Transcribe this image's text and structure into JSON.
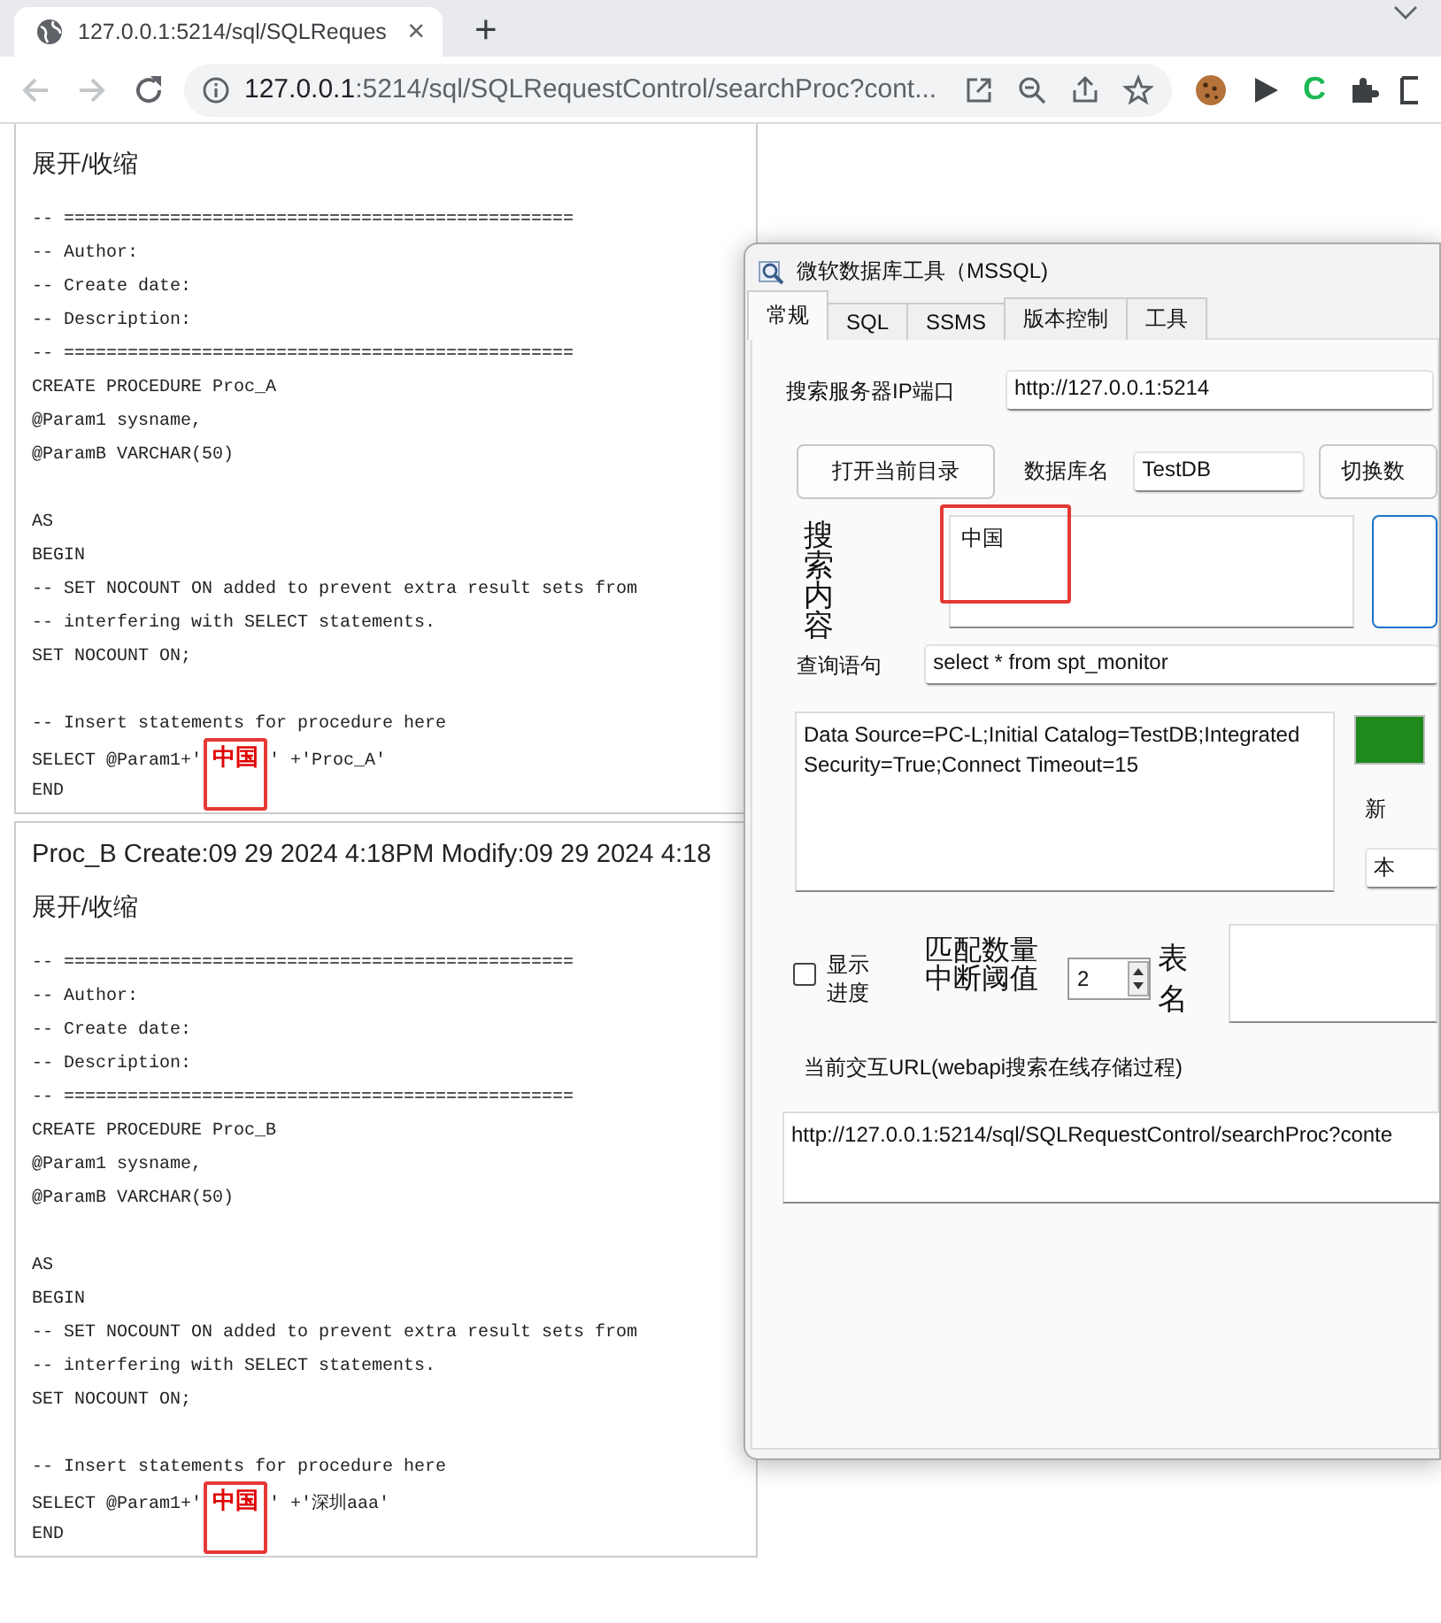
{
  "browser": {
    "tab": {
      "title": "127.0.0.1:5214/sql/SQLReques",
      "close": "×",
      "selected": true
    },
    "new_tab": "+",
    "navigation": [
      {
        "kind": "back",
        "disabled": true
      },
      {
        "kind": "forward",
        "disabled": true
      },
      {
        "kind": "reload",
        "disabled": false
      }
    ],
    "address": {
      "host": "127.0.0.1",
      "path": ":5214/sql/SQLRequestControl/searchProc?cont..."
    },
    "extensions": [
      {
        "kind": "cookie"
      },
      {
        "kind": "play"
      },
      {
        "kind": "letter",
        "text": "C"
      },
      {
        "kind": "puzzle"
      },
      {
        "kind": "panel"
      }
    ]
  },
  "results": [
    {
      "toggle": "展开/收缩",
      "lines": [
        {
          "kind": "code",
          "text": "-- ================================================"
        },
        {
          "kind": "code",
          "text": "-- Author:"
        },
        {
          "kind": "code",
          "text": "-- Create date:"
        },
        {
          "kind": "code",
          "text": "-- Description:"
        },
        {
          "kind": "code",
          "text": "-- ================================================"
        },
        {
          "kind": "code",
          "text": "CREATE PROCEDURE Proc_A"
        },
        {
          "kind": "code",
          "text": "@Param1 sysname,"
        },
        {
          "kind": "code",
          "text": "@ParamB VARCHAR(50)"
        },
        {
          "kind": "blank"
        },
        {
          "kind": "code",
          "text": "AS"
        },
        {
          "kind": "code",
          "text": "BEGIN"
        },
        {
          "kind": "code",
          "text": "-- SET NOCOUNT ON added to prevent extra result sets from"
        },
        {
          "kind": "code",
          "text": "-- interfering with SELECT statements."
        },
        {
          "kind": "code",
          "text": "SET NOCOUNT ON;"
        },
        {
          "kind": "blank"
        },
        {
          "kind": "code",
          "text": "-- Insert statements for procedure here"
        },
        {
          "kind": "match",
          "segments": [
            {
              "text": "SELECT @Param1+'",
              "match": false
            },
            {
              "text": "中国",
              "match": true,
              "boxed": true
            },
            {
              "text": "' +'Proc_A'",
              "match": false
            }
          ]
        },
        {
          "kind": "code",
          "text": "END"
        }
      ]
    },
    {
      "header": "Proc_B Create:09 29 2024 4:18PM Modify:09 29 2024 4:18",
      "toggle": "展开/收缩",
      "lines": [
        {
          "kind": "code",
          "text": "-- ================================================"
        },
        {
          "kind": "code",
          "text": "-- Author:"
        },
        {
          "kind": "code",
          "text": "-- Create date:"
        },
        {
          "kind": "code",
          "text": "-- Description:"
        },
        {
          "kind": "code",
          "text": "-- ================================================"
        },
        {
          "kind": "code",
          "text": "CREATE PROCEDURE Proc_B"
        },
        {
          "kind": "code",
          "text": "@Param1 sysname,"
        },
        {
          "kind": "code",
          "text": "@ParamB VARCHAR(50)"
        },
        {
          "kind": "blank"
        },
        {
          "kind": "code",
          "text": "AS"
        },
        {
          "kind": "code",
          "text": "BEGIN"
        },
        {
          "kind": "code",
          "text": "-- SET NOCOUNT ON added to prevent extra result sets from"
        },
        {
          "kind": "code",
          "text": "-- interfering with SELECT statements."
        },
        {
          "kind": "code",
          "text": "SET NOCOUNT ON;"
        },
        {
          "kind": "blank"
        },
        {
          "kind": "code",
          "text": "-- Insert statements for procedure here"
        },
        {
          "kind": "match",
          "segments": [
            {
              "text": "SELECT @Param1+'",
              "match": false
            },
            {
              "text": "中国",
              "match": true,
              "boxed": true
            },
            {
              "text": "' +'深圳aaa'",
              "match": false
            }
          ]
        },
        {
          "kind": "code",
          "text": "END"
        }
      ]
    }
  ],
  "dialog": {
    "title": "微软数据库工具（MSSQL)",
    "tabs": [
      {
        "label": "常规",
        "selected": true
      },
      {
        "label": "SQL",
        "selected": false
      },
      {
        "label": "SSMS",
        "selected": false
      },
      {
        "label": "版本控制",
        "selected": false
      },
      {
        "label": "工具",
        "selected": false
      }
    ],
    "server": {
      "label": "搜索服务器IP端口",
      "value": "http://127.0.0.1:5214"
    },
    "open_folder_button": "打开当前目录",
    "database": {
      "label": "数据库名",
      "value": "TestDB"
    },
    "switch_button": "切换数",
    "search": {
      "label": "搜索内容",
      "value": "中国",
      "boxed": true
    },
    "query": {
      "label": "查询语句",
      "value": "select * from spt_monitor"
    },
    "connection": {
      "value": "Data Source=PC-L;Initial Catalog=TestDB;Integrated Security=True;Connect Timeout=15"
    },
    "add_label": "新",
    "combo_value": "本",
    "show_progress": {
      "label": "显示进度",
      "checked": false
    },
    "threshold": {
      "label": "匹配数量中断阈值",
      "value": "2"
    },
    "table_name": {
      "label": "表名"
    },
    "url": {
      "label": "当前交互URL(webapi搜索在线存储过程)",
      "value": "http://127.0.0.1:5214/sql/SQLRequestControl/searchProc?conte"
    }
  }
}
